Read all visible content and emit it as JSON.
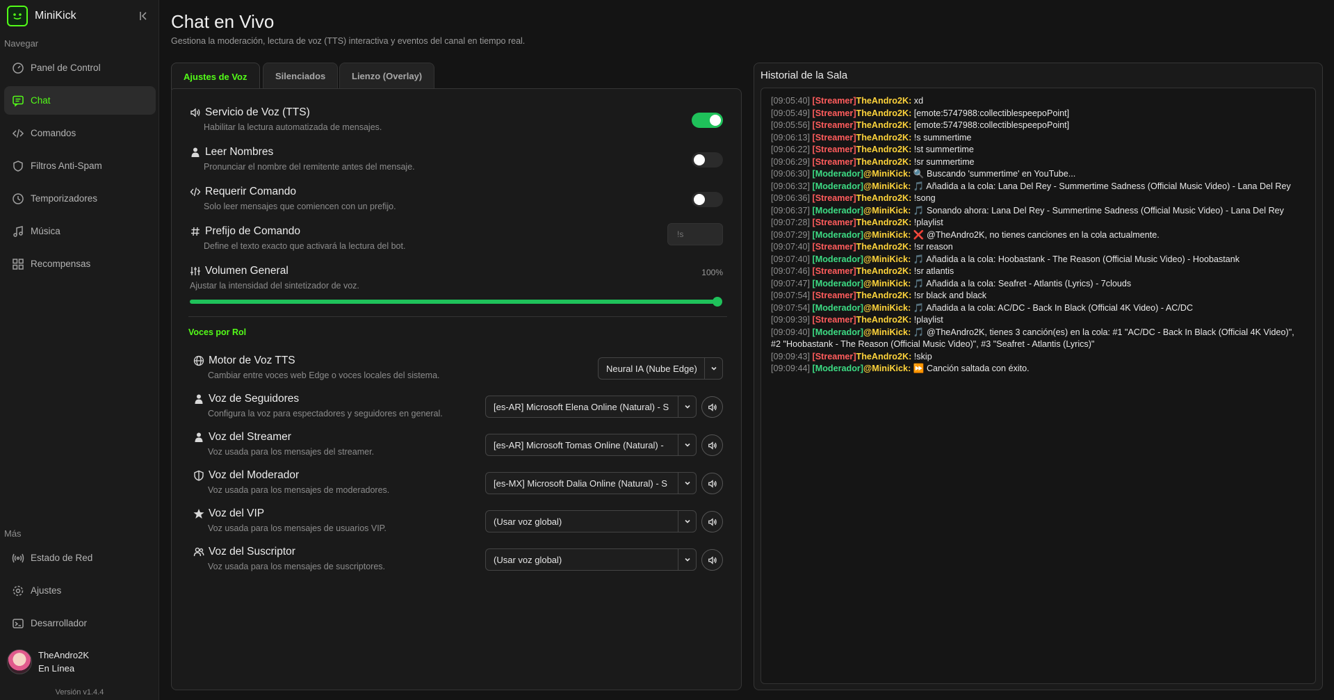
{
  "app": {
    "name": "MiniKick",
    "version": "Versión v1.4.4"
  },
  "sidebar": {
    "nav_label": "Navegar",
    "items": [
      {
        "label": "Panel de Control",
        "icon": "gauge-icon"
      },
      {
        "label": "Chat",
        "icon": "chat-icon",
        "active": true
      },
      {
        "label": "Comandos",
        "icon": "code-icon"
      },
      {
        "label": "Filtros Anti-Spam",
        "icon": "shield-icon"
      },
      {
        "label": "Temporizadores",
        "icon": "clock-icon"
      },
      {
        "label": "Música",
        "icon": "music-icon"
      },
      {
        "label": "Recompensas",
        "icon": "grid-icon"
      }
    ],
    "more_label": "Más",
    "more_items": [
      {
        "label": "Estado de Red",
        "icon": "broadcast-icon"
      },
      {
        "label": "Ajustes",
        "icon": "gear-icon"
      },
      {
        "label": "Desarrollador",
        "icon": "terminal-icon"
      }
    ],
    "user": {
      "name": "TheAndro2K",
      "status": "En Línea"
    }
  },
  "header": {
    "title": "Chat en Vivo",
    "subtitle": "Gestiona la moderación, lectura de voz (TTS) interactiva y eventos del canal en tiempo real."
  },
  "tabs": [
    "Ajustes de Voz",
    "Silenciados",
    "Lienzo (Overlay)"
  ],
  "settings": {
    "tts": {
      "title": "Servicio de Voz (TTS)",
      "desc": "Habilitar la lectura automatizada de mensajes.",
      "enabled": true
    },
    "names": {
      "title": "Leer Nombres",
      "desc": "Pronunciar el nombre del remitente antes del mensaje.",
      "enabled": false
    },
    "require_cmd": {
      "title": "Requerir Comando",
      "desc": "Solo leer mensajes que comiencen con un prefijo.",
      "enabled": false
    },
    "prefix": {
      "title": "Prefijo de Comando",
      "desc": "Define el texto exacto que activará la lectura del bot.",
      "placeholder": "!s"
    },
    "volume": {
      "title": "Volumen General",
      "desc": "Ajustar la intensidad del sintetizador de voz.",
      "value_label": "100%",
      "value": 1.0
    }
  },
  "roles": {
    "label": "Voces por Rol",
    "engine": {
      "title": "Motor de Voz TTS",
      "desc": "Cambiar entre voces web Edge o voces locales del sistema.",
      "value": "Neural IA (Nube Edge)"
    },
    "voices": [
      {
        "title": "Voz de Seguidores",
        "desc": "Configura la voz para espectadores y seguidores en general.",
        "value": "[es-AR] Microsoft Elena Online (Natural) - S",
        "icon": "user-icon"
      },
      {
        "title": "Voz del Streamer",
        "desc": "Voz usada para los mensajes del streamer.",
        "value": "[es-AR] Microsoft Tomas Online (Natural) -",
        "icon": "user-icon"
      },
      {
        "title": "Voz del Moderador",
        "desc": "Voz usada para los mensajes de moderadores.",
        "value": "[es-MX] Microsoft Dalia Online (Natural) - S",
        "icon": "shield-icon"
      },
      {
        "title": "Voz del VIP",
        "desc": "Voz usada para los mensajes de usuarios VIP.",
        "value": "(Usar voz global)",
        "icon": "star-icon"
      },
      {
        "title": "Voz del Suscriptor",
        "desc": "Voz usada para los mensajes de suscriptores.",
        "value": "(Usar voz global)",
        "icon": "users-icon"
      }
    ]
  },
  "chat": {
    "title": "Historial de la Sala",
    "messages": [
      {
        "ts": "[09:05:40]",
        "role": "[Streamer]",
        "kind": "streamer",
        "user": "TheAndro2K:",
        "text": "xd"
      },
      {
        "ts": "[09:05:49]",
        "role": "[Streamer]",
        "kind": "streamer",
        "user": "TheAndro2K:",
        "text": "[emote:5747988:collectiblespeepoPoint]"
      },
      {
        "ts": "[09:05:56]",
        "role": "[Streamer]",
        "kind": "streamer",
        "user": "TheAndro2K:",
        "text": "[emote:5747988:collectiblespeepoPoint]"
      },
      {
        "ts": "[09:06:13]",
        "role": "[Streamer]",
        "kind": "streamer",
        "user": "TheAndro2K:",
        "text": "!s summertime"
      },
      {
        "ts": "[09:06:22]",
        "role": "[Streamer]",
        "kind": "streamer",
        "user": "TheAndro2K:",
        "text": "!st summertime"
      },
      {
        "ts": "[09:06:29]",
        "role": "[Streamer]",
        "kind": "streamer",
        "user": "TheAndro2K:",
        "text": "!sr summertime"
      },
      {
        "ts": "[09:06:30]",
        "role": "[Moderador]",
        "kind": "mod",
        "user": "@MiniKick:",
        "text": "🔍 Buscando 'summertime' en YouTube..."
      },
      {
        "ts": "[09:06:32]",
        "role": "[Moderador]",
        "kind": "mod",
        "user": "@MiniKick:",
        "text": "🎵 Añadida a la cola: Lana Del Rey - Summertime Sadness (Official Music Video) - Lana Del Rey"
      },
      {
        "ts": "[09:06:36]",
        "role": "[Streamer]",
        "kind": "streamer",
        "user": "TheAndro2K:",
        "text": "!song"
      },
      {
        "ts": "[09:06:37]",
        "role": "[Moderador]",
        "kind": "mod",
        "user": "@MiniKick:",
        "text": "🎵 Sonando ahora: Lana Del Rey - Summertime Sadness (Official Music Video) - Lana Del Rey"
      },
      {
        "ts": "[09:07:28]",
        "role": "[Streamer]",
        "kind": "streamer",
        "user": "TheAndro2K:",
        "text": "!playlist"
      },
      {
        "ts": "[09:07:29]",
        "role": "[Moderador]",
        "kind": "mod",
        "user": "@MiniKick:",
        "text": "❌ @TheAndro2K, no tienes canciones en la cola actualmente."
      },
      {
        "ts": "[09:07:40]",
        "role": "[Streamer]",
        "kind": "streamer",
        "user": "TheAndro2K:",
        "text": "!sr reason"
      },
      {
        "ts": "[09:07:40]",
        "role": "[Moderador]",
        "kind": "mod",
        "user": "@MiniKick:",
        "text": "🎵 Añadida a la cola: Hoobastank - The Reason (Official Music Video) - Hoobastank"
      },
      {
        "ts": "[09:07:46]",
        "role": "[Streamer]",
        "kind": "streamer",
        "user": "TheAndro2K:",
        "text": "!sr atlantis"
      },
      {
        "ts": "[09:07:47]",
        "role": "[Moderador]",
        "kind": "mod",
        "user": "@MiniKick:",
        "text": "🎵 Añadida a la cola: Seafret - Atlantis (Lyrics) - 7clouds"
      },
      {
        "ts": "[09:07:54]",
        "role": "[Streamer]",
        "kind": "streamer",
        "user": "TheAndro2K:",
        "text": "!sr black and black"
      },
      {
        "ts": "[09:07:54]",
        "role": "[Moderador]",
        "kind": "mod",
        "user": "@MiniKick:",
        "text": "🎵 Añadida a la cola: AC/DC - Back In Black (Official 4K Video) - AC/DC"
      },
      {
        "ts": "[09:09:39]",
        "role": "[Streamer]",
        "kind": "streamer",
        "user": "TheAndro2K:",
        "text": "!playlist"
      },
      {
        "ts": "[09:09:40]",
        "role": "[Moderador]",
        "kind": "mod",
        "user": "@MiniKick:",
        "text": "🎵 @TheAndro2K, tienes 3 canción(es) en la cola: #1 \"AC/DC - Back In Black (Official 4K Video)\", #2 \"Hoobastank - The Reason (Official Music Video)\", #3 \"Seafret - Atlantis (Lyrics)\""
      },
      {
        "ts": "[09:09:43]",
        "role": "[Streamer]",
        "kind": "streamer",
        "user": "TheAndro2K:",
        "text": "!skip"
      },
      {
        "ts": "[09:09:44]",
        "role": "[Moderador]",
        "kind": "mod",
        "user": "@MiniKick:",
        "text": "⏩ Canción saltada con éxito."
      }
    ]
  },
  "colors": {
    "accent": "#53fc18",
    "toggle_on": "#1fc15a",
    "streamer": "#ff5c5c",
    "moderator": "#3ddc84",
    "username": "#ffd43b"
  }
}
